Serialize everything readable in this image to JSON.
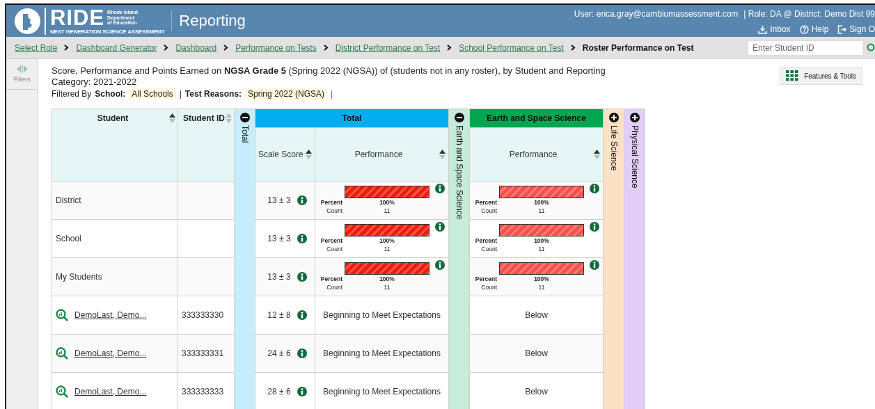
{
  "header": {
    "logo_word": "RIDE",
    "logo_lines": [
      "Rhode Island",
      "Department",
      "of Education"
    ],
    "logo_tagline": "NEXT GENERATION SCIENCE ASSESSMENT",
    "app_title": "Reporting",
    "user": "User: erica.gray@cambiumassessment.com",
    "role": "|  Role: DA @ District: Demo Dist 99",
    "links": [
      {
        "kind": "inbox",
        "label": "Inbox"
      },
      {
        "kind": "help",
        "label": "Help"
      },
      {
        "kind": "signout",
        "label": "Sign O"
      }
    ]
  },
  "breadcrumbs": [
    {
      "label": "Select Role",
      "current": false
    },
    {
      "label": "Dashboard Generator",
      "current": false
    },
    {
      "label": "Dashboard",
      "current": false
    },
    {
      "label": "Performance on Tests",
      "current": false
    },
    {
      "label": "District Performance on Test",
      "current": false
    },
    {
      "label": "School Performance on Test",
      "current": false
    },
    {
      "label": "Roster Performance on Test",
      "current": true
    }
  ],
  "search": {
    "placeholder": "Enter Student ID"
  },
  "sidebar": {
    "label": "Filters",
    "disabled": true
  },
  "report": {
    "title": "Score, Performance and Points Earned on **NGSA Grade 5** (Spring 2022 (NGSA)) of (students not in any roster), by Student and Reporting Category: 2021-2022",
    "filters": [
      {
        "prefix": "Filtered By",
        "name": "School:",
        "value": "All Schools"
      },
      {
        "prefix": "|",
        "name": "Test Reasons:",
        "value": "Spring 2022 (NGSA)"
      }
    ],
    "filters_end": "|",
    "tools_button": "Features & Tools"
  },
  "table": {
    "columns": [
      {
        "label": "Student",
        "sorted": true
      },
      {
        "label": "Student ID",
        "sorted": false
      }
    ],
    "groups": [
      {
        "band_label": "Total",
        "name": "Total",
        "expanded": true,
        "color": "#00aeef",
        "columns": [
          {
            "label": "Scale Score",
            "kind": "score"
          },
          {
            "label": "Performance",
            "kind": "bar"
          }
        ]
      },
      {
        "band_label": "Earth and Space Science",
        "name": "Earth and Space Science",
        "expanded": true,
        "color": "#00a650",
        "columns": [
          {
            "label": "Performance",
            "kind": "bar"
          }
        ]
      },
      {
        "band_label": "Life Science",
        "expanded": false,
        "color": "#fde1c4"
      },
      {
        "band_label": "Physical Science",
        "expanded": false,
        "color": "#e2cdf8"
      }
    ],
    "rows": [
      {
        "kind": "aggregate",
        "name": "District",
        "student_id": "",
        "cells": [
          {
            "kind": "score",
            "text": "13 ± 3"
          },
          {
            "kind": "bar",
            "color": "#ee1c0c",
            "percent_label": "Percent",
            "percent": "100%",
            "count_label": "Count",
            "count": "11"
          },
          {
            "kind": "bar",
            "color": "#f5504c",
            "percent_label": "Percent",
            "percent": "100%",
            "count_label": "Count",
            "count": "11"
          }
        ]
      },
      {
        "kind": "aggregate",
        "name": "School",
        "student_id": "",
        "cells": [
          {
            "kind": "score",
            "text": "13 ± 3"
          },
          {
            "kind": "bar",
            "color": "#ee1c0c",
            "percent_label": "Percent",
            "percent": "100%",
            "count_label": "Count",
            "count": "11"
          },
          {
            "kind": "bar",
            "color": "#f5504c",
            "percent_label": "Percent",
            "percent": "100%",
            "count_label": "Count",
            "count": "11"
          }
        ]
      },
      {
        "kind": "aggregate",
        "name": "My Students",
        "student_id": "",
        "cells": [
          {
            "kind": "score",
            "text": "13 ± 3"
          },
          {
            "kind": "bar",
            "color": "#ee1c0c",
            "percent_label": "Percent",
            "percent": "100%",
            "count_label": "Count",
            "count": "11"
          },
          {
            "kind": "bar",
            "color": "#f5504c",
            "percent_label": "Percent",
            "percent": "100%",
            "count_label": "Count",
            "count": "11"
          }
        ]
      },
      {
        "kind": "student",
        "name": "DemoLast, Demo...",
        "student_id": "333333330",
        "cells": [
          {
            "kind": "score",
            "text": "12 ± 8"
          },
          {
            "kind": "text",
            "text": "Beginning to Meet Expectations"
          },
          {
            "kind": "text",
            "text": "Below"
          }
        ]
      },
      {
        "kind": "student",
        "name": "DemoLast, Demo...",
        "student_id": "333333331",
        "cells": [
          {
            "kind": "score",
            "text": "24 ± 6"
          },
          {
            "kind": "text",
            "text": "Beginning to Meet Expectations"
          },
          {
            "kind": "text",
            "text": "Below"
          }
        ]
      },
      {
        "kind": "student",
        "name": "DemoLast, Demo...",
        "student_id": "333333333",
        "cells": [
          {
            "kind": "score",
            "text": "28 ± 6"
          },
          {
            "kind": "text",
            "text": "Beginning to Meet Expectations"
          },
          {
            "kind": "text",
            "text": "Below"
          }
        ]
      }
    ]
  }
}
